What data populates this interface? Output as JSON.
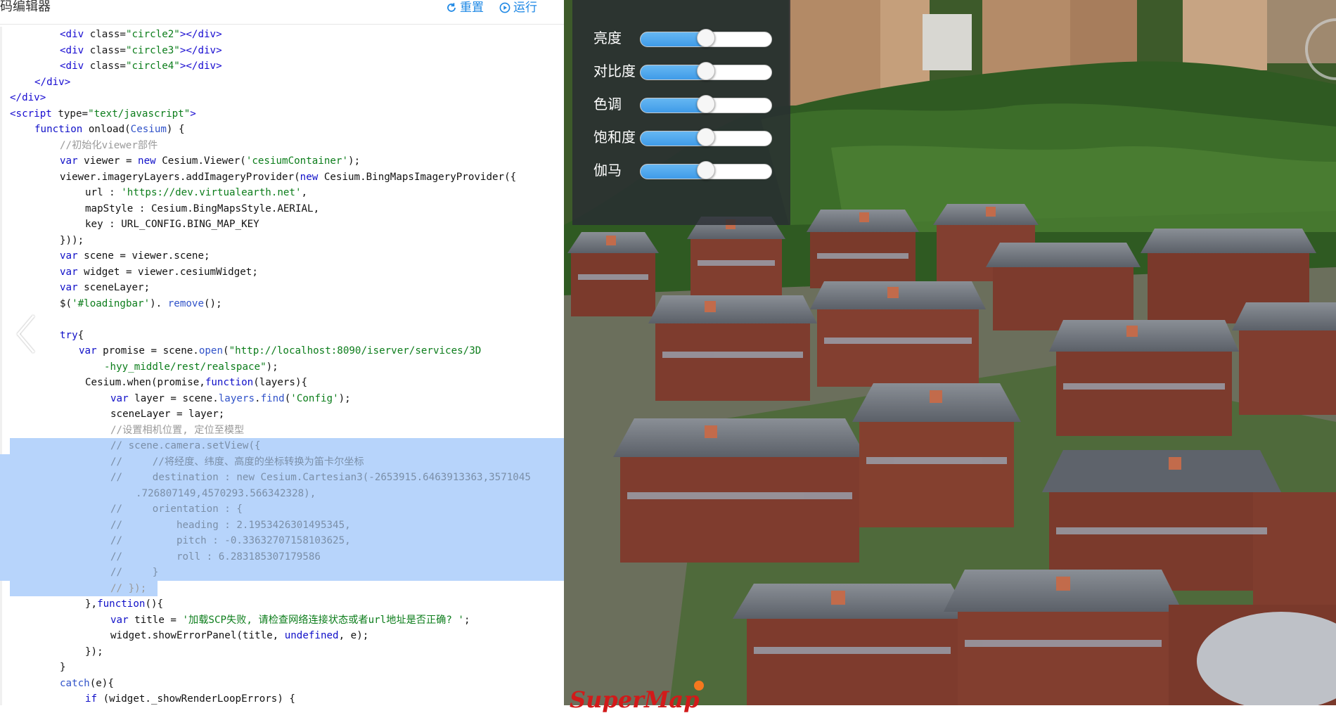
{
  "editor": {
    "title": "码编辑器",
    "reset_label": "重置",
    "run_label": "运行",
    "code_lines": [
      {
        "indent": 85,
        "sel": false,
        "parts": [
          [
            "tag",
            "<div "
          ],
          [
            "attr",
            "class="
          ],
          [
            "str",
            "\"circle2\""
          ],
          [
            "tag",
            "></div>"
          ]
        ]
      },
      {
        "indent": 85,
        "sel": false,
        "parts": [
          [
            "tag",
            "<div "
          ],
          [
            "attr",
            "class="
          ],
          [
            "str",
            "\"circle3\""
          ],
          [
            "tag",
            "></div>"
          ]
        ]
      },
      {
        "indent": 85,
        "sel": false,
        "parts": [
          [
            "tag",
            "<div "
          ],
          [
            "attr",
            "class="
          ],
          [
            "str",
            "\"circle4\""
          ],
          [
            "tag",
            "></div>"
          ]
        ]
      },
      {
        "indent": 49,
        "sel": false,
        "parts": [
          [
            "tag",
            "</div>"
          ]
        ]
      },
      {
        "indent": 14,
        "sel": false,
        "parts": [
          [
            "tag",
            "</div>"
          ]
        ]
      },
      {
        "indent": 14,
        "sel": false,
        "parts": [
          [
            "tag",
            "<script "
          ],
          [
            "attr",
            "type="
          ],
          [
            "str",
            "\"text/javascript\""
          ],
          [
            "tag",
            ">"
          ]
        ]
      },
      {
        "indent": 49,
        "sel": false,
        "parts": [
          [
            "kw",
            "function "
          ],
          [
            "fn",
            "onload("
          ],
          [
            "blue",
            "Cesium"
          ],
          [
            "fn",
            ") {"
          ]
        ]
      },
      {
        "indent": 85,
        "sel": false,
        "parts": [
          [
            "cm",
            "//初始化viewer部件"
          ]
        ]
      },
      {
        "indent": 85,
        "sel": false,
        "parts": [
          [
            "kw",
            "var "
          ],
          [
            "fn",
            "viewer = "
          ],
          [
            "kw",
            "new "
          ],
          [
            "fn",
            "Cesium.Viewer("
          ],
          [
            "str",
            "'cesiumContainer'"
          ],
          [
            "fn",
            ");"
          ]
        ]
      },
      {
        "indent": 85,
        "sel": false,
        "parts": [
          [
            "fn",
            "viewer.imageryLayers.addImageryProvider("
          ],
          [
            "kw",
            "new "
          ],
          [
            "fn",
            "Cesium.BingMapsImageryProvider({"
          ]
        ]
      },
      {
        "indent": 121,
        "sel": false,
        "parts": [
          [
            "fn",
            "url : "
          ],
          [
            "str",
            "'https://dev.virtualearth.net'"
          ],
          [
            "fn",
            ","
          ]
        ]
      },
      {
        "indent": 121,
        "sel": false,
        "parts": [
          [
            "fn",
            "mapStyle : Cesium.BingMapsStyle.AERIAL,"
          ]
        ]
      },
      {
        "indent": 121,
        "sel": false,
        "parts": [
          [
            "fn",
            "key : URL_CONFIG.BING_MAP_KEY"
          ]
        ]
      },
      {
        "indent": 85,
        "sel": false,
        "parts": [
          [
            "fn",
            "}));"
          ]
        ]
      },
      {
        "indent": 85,
        "sel": false,
        "parts": [
          [
            "kw",
            "var "
          ],
          [
            "fn",
            "scene = viewer.scene;"
          ]
        ]
      },
      {
        "indent": 85,
        "sel": false,
        "parts": [
          [
            "kw",
            "var "
          ],
          [
            "fn",
            "widget = viewer.cesiumWidget;"
          ]
        ]
      },
      {
        "indent": 85,
        "sel": false,
        "parts": [
          [
            "kw",
            "var "
          ],
          [
            "fn",
            "sceneLayer;"
          ]
        ]
      },
      {
        "indent": 85,
        "sel": false,
        "parts": [
          [
            "fn",
            "$("
          ],
          [
            "str",
            "'#loadingbar'"
          ],
          [
            "fn",
            "). "
          ],
          [
            "blue",
            "remove"
          ],
          [
            "fn",
            "();"
          ]
        ]
      },
      {
        "indent": 85,
        "sel": false,
        "parts": []
      },
      {
        "indent": 85,
        "sel": false,
        "parts": [
          [
            "kw",
            "try"
          ],
          [
            "fn",
            "{"
          ]
        ]
      },
      {
        "indent": 112,
        "sel": false,
        "parts": [
          [
            "kw",
            "var "
          ],
          [
            "fn",
            "promise = scene."
          ],
          [
            "blue",
            "open"
          ],
          [
            "fn",
            "("
          ],
          [
            "str",
            "\"http://localhost:8090/iserver/services/3D"
          ]
        ]
      },
      {
        "indent": 148,
        "sel": false,
        "parts": [
          [
            "str",
            "-hyy_middle/rest/realspace\""
          ],
          [
            "fn",
            ");"
          ]
        ]
      },
      {
        "indent": 121,
        "sel": false,
        "parts": [
          [
            "fn",
            "Cesium.when(promise,"
          ],
          [
            "kw",
            "function"
          ],
          [
            "fn",
            "(layers){"
          ]
        ]
      },
      {
        "indent": 157,
        "sel": false,
        "parts": [
          [
            "kw",
            "var "
          ],
          [
            "fn",
            "layer = scene."
          ],
          [
            "blue",
            "layers"
          ],
          [
            "fn",
            "."
          ],
          [
            "blue",
            "find"
          ],
          [
            "fn",
            "("
          ],
          [
            "str",
            "'Config'"
          ],
          [
            "fn",
            ");"
          ]
        ]
      },
      {
        "indent": 157,
        "sel": false,
        "parts": [
          [
            "fn",
            "sceneLayer = layer;"
          ]
        ]
      },
      {
        "indent": 157,
        "sel": false,
        "parts": [
          [
            "cm",
            "//设置相机位置, 定位至模型"
          ]
        ]
      },
      {
        "indent": 157,
        "sel": true,
        "parts": [
          [
            "cm",
            "// scene.camera.setView({"
          ]
        ]
      },
      {
        "indent": 157,
        "sel": true,
        "parts": [
          [
            "cm",
            "//     //将经度、纬度、高度的坐标转换为笛卡尔坐标"
          ]
        ]
      },
      {
        "indent": 157,
        "sel": true,
        "parts": [
          [
            "cm",
            "//     destination : new Cesium.Cartesian3(-2653915.6463913363,3571045"
          ]
        ]
      },
      {
        "indent": 193,
        "sel": true,
        "parts": [
          [
            "cm",
            ".726807149,4570293.566342328),"
          ]
        ]
      },
      {
        "indent": 157,
        "sel": true,
        "parts": [
          [
            "cm",
            "//     orientation : {"
          ]
        ]
      },
      {
        "indent": 157,
        "sel": true,
        "parts": [
          [
            "cm",
            "//         heading : 2.1953426301495345,"
          ]
        ]
      },
      {
        "indent": 157,
        "sel": true,
        "parts": [
          [
            "cm",
            "//         pitch : -0.33632707158103625,"
          ]
        ]
      },
      {
        "indent": 157,
        "sel": true,
        "parts": [
          [
            "cm",
            "//         roll : 6.283185307179586"
          ]
        ]
      },
      {
        "indent": 157,
        "sel": true,
        "parts": [
          [
            "cm",
            "//     }"
          ]
        ]
      },
      {
        "indent": 157,
        "sel": "partial",
        "parts": [
          [
            "cm",
            "// });"
          ]
        ]
      },
      {
        "indent": 121,
        "sel": false,
        "parts": [
          [
            "fn",
            "},"
          ],
          [
            "kw",
            "function"
          ],
          [
            "fn",
            "(){"
          ]
        ]
      },
      {
        "indent": 157,
        "sel": false,
        "parts": [
          [
            "kw",
            "var "
          ],
          [
            "fn",
            "title = "
          ],
          [
            "str",
            "'加载SCP失败, 请检查网络连接状态或者url地址是否正确? '"
          ],
          [
            "fn",
            ";"
          ]
        ]
      },
      {
        "indent": 157,
        "sel": false,
        "parts": [
          [
            "fn",
            "widget.showErrorPanel(title, "
          ],
          [
            "kw",
            "undefined"
          ],
          [
            "fn",
            ", e);"
          ]
        ]
      },
      {
        "indent": 121,
        "sel": false,
        "parts": [
          [
            "fn",
            "});"
          ]
        ]
      },
      {
        "indent": 85,
        "sel": false,
        "parts": [
          [
            "fn",
            "}"
          ]
        ]
      },
      {
        "indent": 85,
        "sel": false,
        "parts": [
          [
            "blue",
            "catch"
          ],
          [
            "fn",
            "(e){"
          ]
        ]
      },
      {
        "indent": 121,
        "sel": false,
        "parts": [
          [
            "kw",
            "if "
          ],
          [
            "fn",
            "(widget._showRenderLoopErrors) {"
          ]
        ]
      }
    ]
  },
  "controls": [
    {
      "label": "亮度",
      "value": 0.5
    },
    {
      "label": "对比度",
      "value": 0.5
    },
    {
      "label": "色调",
      "value": 0.5
    },
    {
      "label": "饱和度",
      "value": 0.5
    },
    {
      "label": "伽马",
      "value": 0.5
    }
  ],
  "viewer": {
    "logo_text": "SuperMap"
  },
  "colors": {
    "accent": "#1e88e5",
    "selection": "#b7d4fb",
    "slider_fill": "#4aa3ec"
  }
}
